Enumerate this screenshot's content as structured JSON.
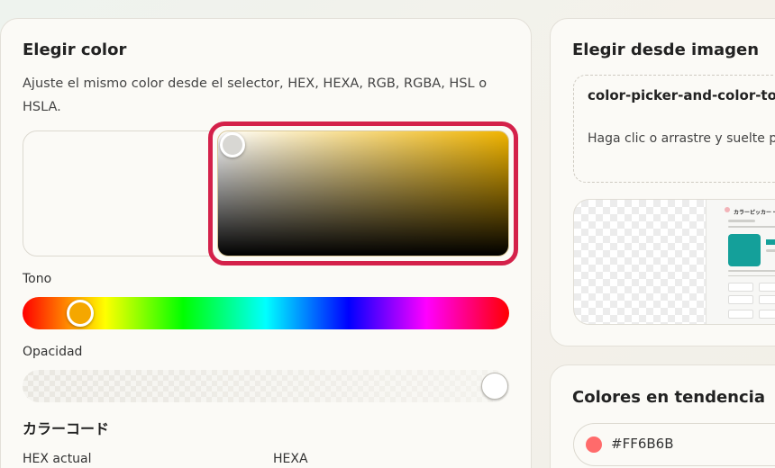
{
  "picker": {
    "title": "Elegir color",
    "description": "Ajuste el mismo color desde el selector, HEX, HEXA, RGB, RGBA, HSL o HSLA.",
    "hue_label": "Tono",
    "opacity_label": "Opacidad",
    "color_code_heading": "カラーコード",
    "hex_current_label": "HEX actual",
    "hexa_label": "HEXA",
    "hue_position": 0.12,
    "opacity_position": 1.0,
    "current_hue_color": "#f0b400"
  },
  "image_picker": {
    "title": "Elegir desde imagen",
    "file_name": "color-picker-and-color-to",
    "drop_hint": "Haga clic o arrastre y suelte p",
    "thumbnail_title": "カラーピッカー・カラ",
    "thumbnail_accent": "#14a09a"
  },
  "trending": {
    "title": "Colores en tendencia",
    "items": [
      {
        "hex": "#FF6B6B",
        "color": "#ff6b6b"
      }
    ]
  },
  "colors": {
    "highlight_border": "#d4214a"
  }
}
